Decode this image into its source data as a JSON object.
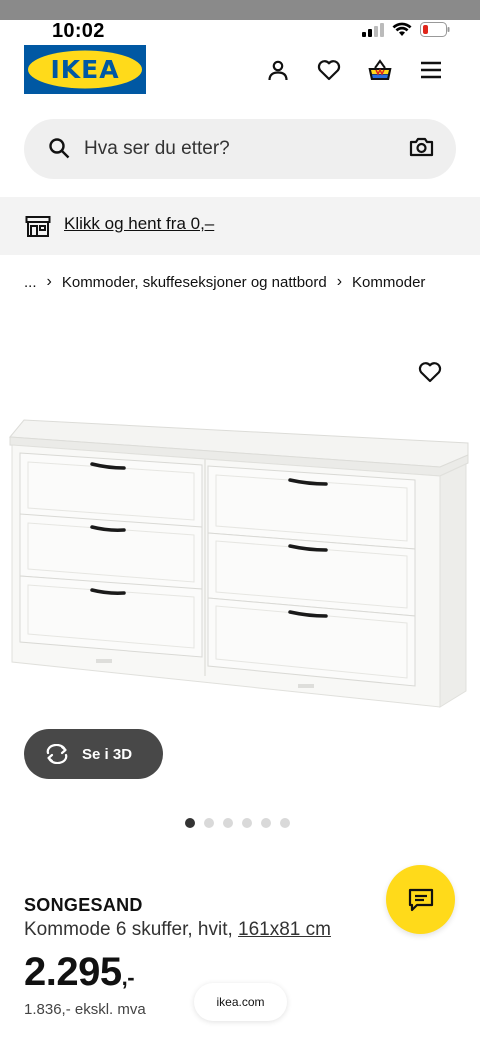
{
  "status_bar": {
    "time": "10:02"
  },
  "brand": {
    "logo_text": "IKEA",
    "blue": "#0058a3",
    "yellow": "#ffda1a"
  },
  "header": {
    "icons": [
      "user-icon",
      "heart-icon",
      "basket-icon",
      "menu-icon"
    ]
  },
  "search": {
    "placeholder": "Hva ser du etter?"
  },
  "pickup": {
    "text": "Klikk og hent fra 0,–"
  },
  "breadcrumb": {
    "ellipsis": "...",
    "items": [
      "Kommoder, skuffeseksjoner og nattbord",
      "Kommoder"
    ]
  },
  "gallery": {
    "button_3d": "Se i 3D",
    "dot_count": 6,
    "active_dot": 0
  },
  "product": {
    "name": "SONGESAND",
    "description": "Kommode 6 skuffer, hvit, ",
    "dimensions": "161x81 cm",
    "price": "2.295",
    "price_suffix": ",-",
    "price_ex_vat": "1.836,- ekskl. mva"
  },
  "browser": {
    "url": "ikea.com"
  }
}
